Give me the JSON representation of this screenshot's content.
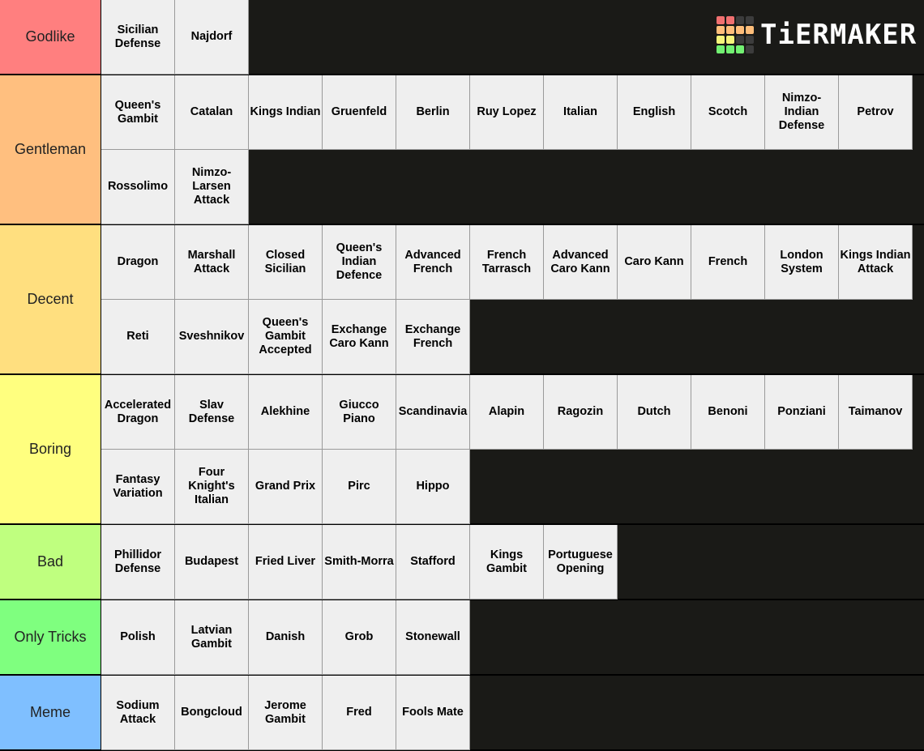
{
  "logo": {
    "text": "TiERMAKER",
    "grid_colors": [
      "#f07070",
      "#f07070",
      "#3c3c3c",
      "#3c3c3c",
      "#ffbe7a",
      "#ffbe7a",
      "#ffbe7a",
      "#ffbe7a",
      "#f5f57a",
      "#f5f57a",
      "#3c3c3c",
      "#3c3c3c",
      "#72f072",
      "#72f072",
      "#72f072",
      "#3c3c3c"
    ]
  },
  "tiers": [
    {
      "label": "Godlike",
      "color": "#ff7f7f",
      "items": [
        "Sicilian Defense",
        "Najdorf"
      ]
    },
    {
      "label": "Gentleman",
      "color": "#ffbf7f",
      "items": [
        "Queen's Gambit",
        "Catalan",
        "Kings Indian",
        "Gruenfeld",
        "Berlin",
        "Ruy Lopez",
        "Italian",
        "English",
        "Scotch",
        "Nimzo-Indian Defense",
        "Petrov",
        "Rossolimo",
        "Nimzo-Larsen Attack"
      ]
    },
    {
      "label": "Decent",
      "color": "#ffdf7f",
      "items": [
        "Dragon",
        "Marshall Attack",
        "Closed Sicilian",
        "Queen's Indian Defence",
        "Advanced French",
        "French Tarrasch",
        "Advanced Caro Kann",
        "Caro Kann",
        "French",
        "London System",
        "Kings Indian Attack",
        "Reti",
        "Sveshnikov",
        "Queen's Gambit Accepted",
        "Exchange Caro Kann",
        "Exchange French"
      ]
    },
    {
      "label": "Boring",
      "color": "#ffff7f",
      "items": [
        "Accelerated Dragon",
        "Slav Defense",
        "Alekhine",
        "Giucco Piano",
        "Scandinavia",
        "Alapin",
        "Ragozin",
        "Dutch",
        "Benoni",
        "Ponziani",
        "Taimanov",
        "Fantasy Variation",
        "Four Knight's Italian",
        "Grand Prix",
        "Pirc",
        "Hippo"
      ]
    },
    {
      "label": "Bad",
      "color": "#bfff7f",
      "items": [
        "Phillidor Defense",
        "Budapest",
        "Fried Liver",
        "Smith-Morra",
        "Stafford",
        "Kings Gambit",
        "Portuguese Opening"
      ]
    },
    {
      "label": "Only Tricks",
      "color": "#7fff7f",
      "items": [
        "Polish",
        "Latvian Gambit",
        "Danish",
        "Grob",
        "Stonewall"
      ]
    },
    {
      "label": "Meme",
      "color": "#7fbfff",
      "items": [
        "Sodium Attack",
        "Bongcloud",
        "Jerome Gambit",
        "Fred",
        "Fools Mate"
      ]
    }
  ]
}
